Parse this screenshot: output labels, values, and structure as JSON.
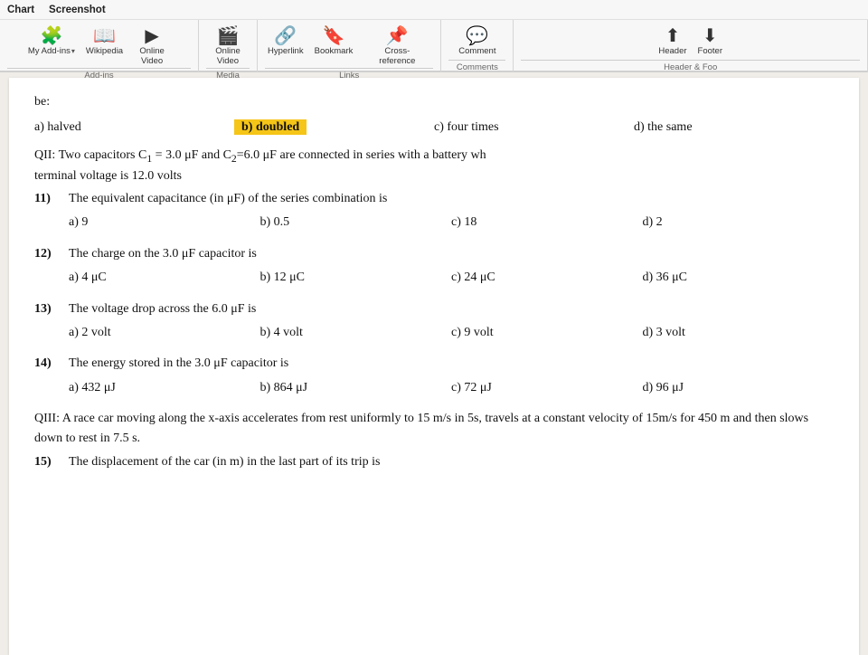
{
  "ribbon": {
    "top_tabs": [
      {
        "id": "chart",
        "label": "Chart"
      },
      {
        "id": "screenshot",
        "label": "Screenshot"
      }
    ],
    "groups": [
      {
        "id": "addins",
        "label": "Add-ins",
        "items": [
          {
            "id": "my-addins",
            "label": "My Add-ins",
            "icon": "🧩",
            "has_dropdown": true
          },
          {
            "id": "wikipedia",
            "label": "Wikipedia",
            "icon": "📖"
          },
          {
            "id": "online-video",
            "label": "Online\nVideo",
            "icon": "▶"
          }
        ]
      },
      {
        "id": "media",
        "label": "Media",
        "items": [
          {
            "id": "online-video2",
            "label": "Online\nVideo",
            "icon": "🎬"
          }
        ]
      },
      {
        "id": "links",
        "label": "Links",
        "items": [
          {
            "id": "hyperlink",
            "label": "Hyperlink",
            "icon": "🔗"
          },
          {
            "id": "bookmark",
            "label": "Bookmark",
            "icon": "🔖"
          },
          {
            "id": "cross-ref",
            "label": "Cross-\nreference",
            "icon": "📌"
          }
        ]
      },
      {
        "id": "comments",
        "label": "Comments",
        "items": [
          {
            "id": "comment",
            "label": "Comment",
            "icon": "💬"
          }
        ]
      },
      {
        "id": "header-footer",
        "label": "Header & Foo",
        "items": [
          {
            "id": "header",
            "label": "Header",
            "icon": "⬆"
          },
          {
            "id": "footer",
            "label": "Footer",
            "icon": "⬇"
          }
        ]
      }
    ]
  },
  "content": {
    "be_line": "be:",
    "q_intro_label": "a) halved",
    "q_intro_highlighted": "b) doubled",
    "q_intro_c": "c) four times",
    "q_intro_d": "d) the same",
    "qii_intro": "QII: Two capacitors C₁ = 3.0 μF and C₂=6.0 μF are connected in series with a battery wh terminal voltage is 12.0 volts",
    "questions": [
      {
        "num": "11)",
        "text": "The equivalent capacitance (in μF) of the series combination is",
        "options": [
          {
            "label": "a) 9"
          },
          {
            "label": "b) 0.5"
          },
          {
            "label": "c) 18"
          },
          {
            "label": "d) 2"
          }
        ]
      },
      {
        "num": "12)",
        "text": "The charge on the 3.0 μF capacitor is",
        "options": [
          {
            "label": "a) 4 μC"
          },
          {
            "label": "b) 12 μC"
          },
          {
            "label": "c) 24 μC"
          },
          {
            "label": "d) 36 μC"
          }
        ]
      },
      {
        "num": "13)",
        "text": "The voltage drop across the 6.0 μF is",
        "options": [
          {
            "label": "a) 2 volt"
          },
          {
            "label": "b) 4 volt"
          },
          {
            "label": "c) 9 volt"
          },
          {
            "label": "d) 3 volt"
          }
        ]
      },
      {
        "num": "14)",
        "text": "The energy stored in the 3.0 μF capacitor is",
        "options": [
          {
            "label": "a) 432 μJ"
          },
          {
            "label": "b) 864 μJ"
          },
          {
            "label": "c) 72 μJ"
          },
          {
            "label": "d) 96 μJ"
          }
        ]
      }
    ],
    "qiii_intro": "QIII: A race car moving along the x-axis accelerates from rest uniformly to 15 m/s in 5s, travels at a constant velocity of 15m/s for 450 m and then slows down to rest in 7.5 s.",
    "q15_num": "15)",
    "q15_text": "The displacement of the car (in m) in the last part of its trip is"
  }
}
